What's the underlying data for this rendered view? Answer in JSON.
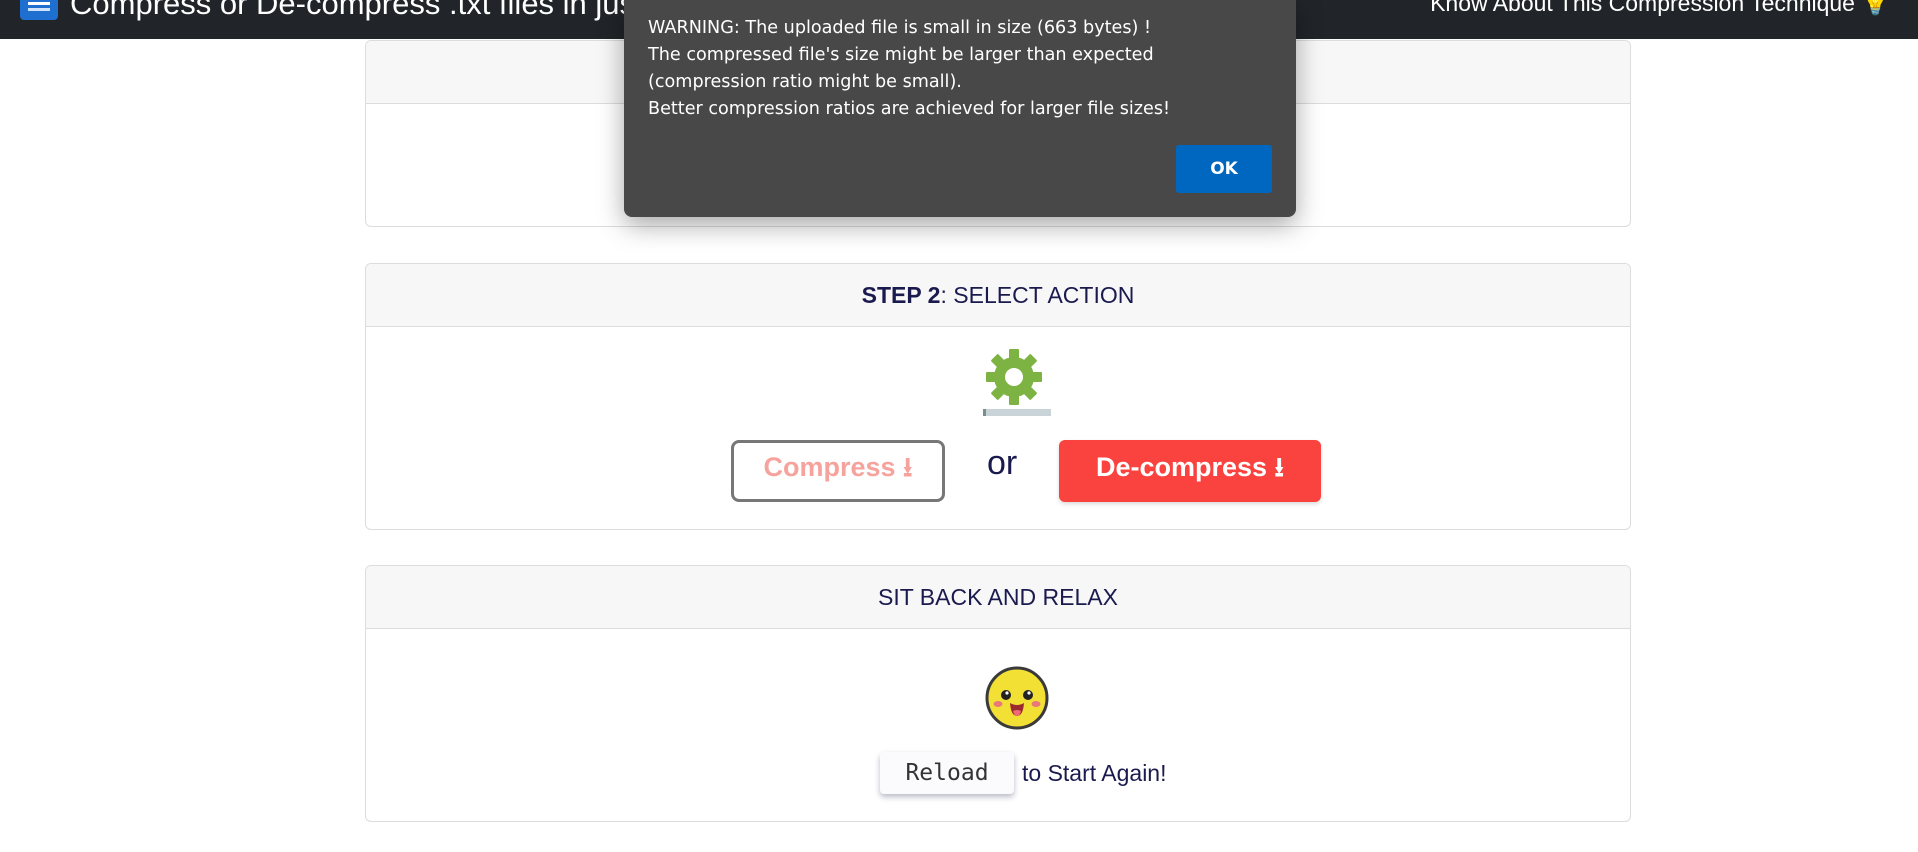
{
  "topbar": {
    "title": "Compress or De-compress .txt files in just",
    "nav_link": "Know About This Compression Technique 💡"
  },
  "step2": {
    "header_strong": "STEP 2",
    "header_rest": ": SELECT ACTION",
    "compress_label": "Compress ⭳",
    "or_text": "or",
    "decompress_label": "De-compress ⭳",
    "progress_fraction": 0.05
  },
  "step3": {
    "header": "SIT BACK AND RELAX",
    "reload_label": "Reload",
    "reload_tail": "to Start Again!"
  },
  "dialog": {
    "line1": "WARNING: The uploaded file is small in size (663 bytes) !",
    "line2": "The compressed file's size might be larger than expected (compression ratio might be small).",
    "line3": "Better compression ratios are achieved for larger file sizes!",
    "ok_label": "OK"
  },
  "colors": {
    "topbar": "#212529",
    "decompress_button": "#fa423e",
    "compress_text": "#f6a39e",
    "gear": "#7cb342",
    "dialog_bg": "#484848",
    "dialog_ok": "#0067c0"
  }
}
